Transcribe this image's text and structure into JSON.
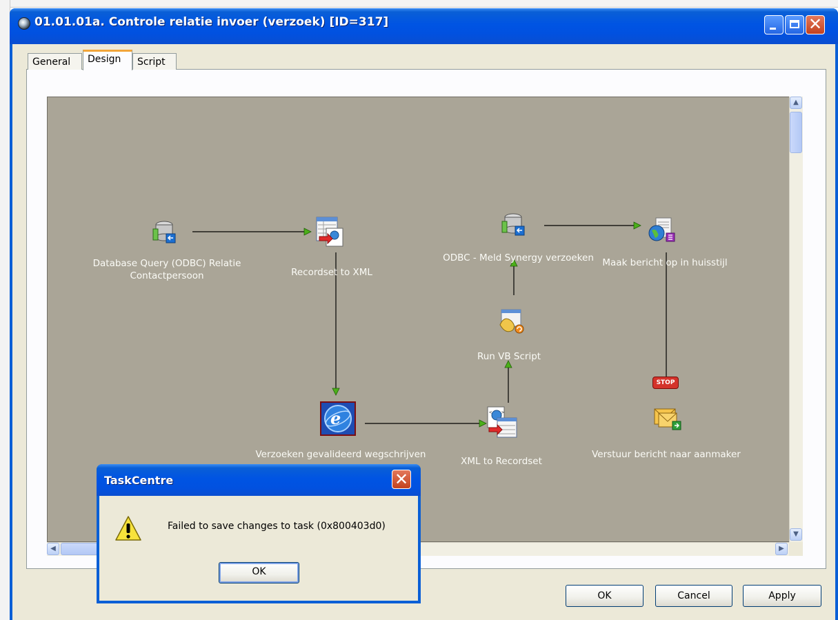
{
  "window": {
    "title": "01.01.01a. Controle relatie invoer (verzoek) [ID=317]",
    "minimize_label": "minimize",
    "maximize_label": "maximize",
    "close_label": "close"
  },
  "tabs": [
    {
      "label": "General",
      "selected": false
    },
    {
      "label": "Design",
      "selected": true
    },
    {
      "label": "Script",
      "selected": false
    }
  ],
  "workflow": {
    "nodes": [
      {
        "id": "db-query",
        "label_line1": "Database Query (ODBC) Relatie",
        "label_line2": "Contactpersoon",
        "icon": "database-query-icon"
      },
      {
        "id": "rs-to-xml",
        "label": "Recordset to XML",
        "icon": "recordset-to-xml-icon"
      },
      {
        "id": "odbc-meld",
        "label": "ODBC - Meld Synergy verzoeken",
        "icon": "database-query-icon"
      },
      {
        "id": "maak-bericht",
        "label": "Maak bericht op in huisstijl",
        "icon": "message-compose-icon"
      },
      {
        "id": "run-vb",
        "label": "Run VB Script",
        "icon": "vb-script-icon"
      },
      {
        "id": "stop",
        "label": "STOP",
        "icon": "stop-icon"
      },
      {
        "id": "verzoeken",
        "label": "Verzoeken gevalideerd wegschrijven",
        "icon": "connector-icon"
      },
      {
        "id": "xml-to-rs",
        "label": "XML to Recordset",
        "icon": "xml-to-recordset-icon"
      },
      {
        "id": "verstuur",
        "label": "Verstuur bericht naar aanmaker",
        "icon": "send-mail-icon"
      }
    ]
  },
  "buttons": {
    "ok": "OK",
    "cancel": "Cancel",
    "apply": "Apply"
  },
  "dialog": {
    "title": "TaskCentre",
    "message": "Failed to save changes to task (0x800403d0)",
    "ok": "OK",
    "icon": "warning-icon"
  },
  "colors": {
    "titlebar": "#0054e3",
    "canvas": "#aaa597",
    "connector": "#000000",
    "arrowhead": "#4caf1a",
    "tab_highlight": "#f2a53a"
  }
}
